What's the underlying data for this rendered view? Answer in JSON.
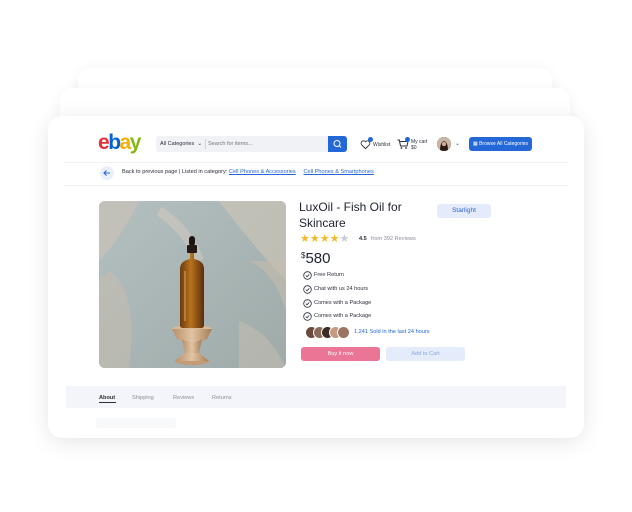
{
  "header": {
    "logo": [
      "e",
      "b",
      "a",
      "y"
    ],
    "logo_colors": [
      "#e53238",
      "#0064d2",
      "#f5af02",
      "#86b817"
    ],
    "category_select": "All Categories",
    "search_placeholder": "Search for items...",
    "wishlist_label": "Wishlist",
    "cart_label": "My cart",
    "cart_total": "$0",
    "browse_button": "Browse All Categories"
  },
  "breadcrumb": {
    "prefix": "Back to previous page | Listed in category:",
    "links": [
      "Cell Phones & Accessories",
      "Cell Phones & Smartphones"
    ]
  },
  "product": {
    "title": "LuxOil - Fish Oil for Skincare",
    "tag": "Starlight",
    "rating_value": "4.5",
    "reviews_text": "from 392 Reviews",
    "currency": "$",
    "price": "580",
    "features": [
      "Free Return",
      "Chat with us 24 hours",
      "Comes with a Package",
      "Comes with a Package"
    ],
    "sold_text": "1,241 Sold in the last 24 hours",
    "buy_button": "Buy it now",
    "add_to_cart_button": "Add to Cart"
  },
  "tabs": [
    "About",
    "Shipping",
    "Reviews",
    "Returns"
  ],
  "colors": {
    "accent": "#2467d6",
    "buy": "#ea7594",
    "star": "#f3b72a"
  }
}
